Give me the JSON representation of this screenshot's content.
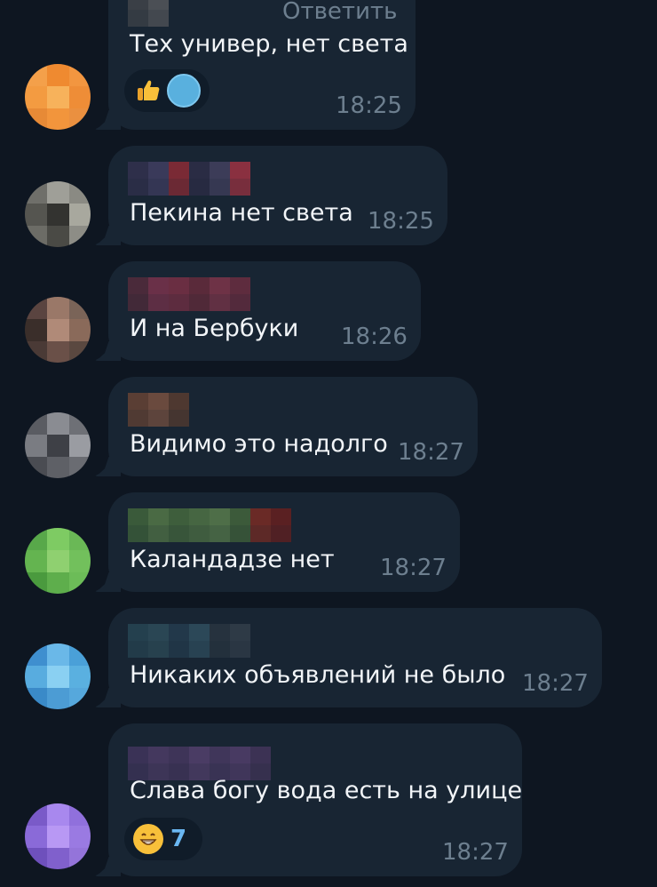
{
  "chat": {
    "messages": [
      {
        "text": "Тех универ, нет света",
        "time": "18:25",
        "reply_label": "Ответить",
        "reactions": [
          "thumbs-up",
          "blue-avatar"
        ],
        "avatar_colors": [
          "#f4a04a",
          "#ef8a30",
          "#f29640",
          "#f39b41",
          "#f7b25b",
          "#ee8d37",
          "#e78a36",
          "#f2953c",
          "#ea9040"
        ],
        "sender_colors": [
          "#3a3f46",
          "#4b4f55"
        ]
      },
      {
        "text": "Пекина нет света",
        "time": "18:25",
        "avatar_colors": [
          "#6f6f6a",
          "#9f9f98",
          "#8a8a83",
          "#555550",
          "#333330",
          "#a8a89e",
          "#6c6c66",
          "#4a4a45",
          "#8d8d86"
        ],
        "sender_colors": [
          "#2e2f4a",
          "#3a3a5a",
          "#7a2a35",
          "#2a2c44",
          "#3c3c58",
          "#8a3040"
        ]
      },
      {
        "text": "И на Бербуки",
        "time": "18:26",
        "avatar_colors": [
          "#5a4440",
          "#9a7868",
          "#7a6458",
          "#3a2e2a",
          "#b08a78",
          "#8a6a5a",
          "#4a3a36",
          "#6a5048",
          "#5a4840"
        ],
        "sender_colors": [
          "#4a2a3a",
          "#6a3048",
          "#6a2e42",
          "#5a2a3a",
          "#6e3246",
          "#5e2c3e"
        ]
      },
      {
        "text": "Видимо это надолго",
        "time": "18:27",
        "avatar_colors": [
          "#5a5c62",
          "#8a8c92",
          "#6e7076",
          "#7a7c82",
          "#3e4046",
          "#9a9ca2",
          "#4a4c52",
          "#5e6066",
          "#6a6c72"
        ],
        "sender_colors": [
          "#5a3e34",
          "#6a4a3e",
          "#4e3830"
        ]
      },
      {
        "text": "Каландадзе нет",
        "time": "18:27",
        "avatar_colors": [
          "#58a84a",
          "#7ecb63",
          "#6ab856",
          "#64b450",
          "#8fd070",
          "#72c05c",
          "#4a9a3e",
          "#5eae4c",
          "#6cbc58"
        ],
        "sender_colors": [
          "#3a5a3a",
          "#4a6a44",
          "#3e5e3c",
          "#466642",
          "#4e6e48",
          "#3c5a3a",
          "#6a2a26",
          "#5a2022"
        ]
      },
      {
        "text": "Никаких объявлений не было",
        "time": "18:27",
        "avatar_colors": [
          "#3f8fcf",
          "#6ab8e8",
          "#4aa0d8",
          "#58acdf",
          "#8ad0f2",
          "#5ab0e0",
          "#3a8ac8",
          "#4c9cd4",
          "#56a8dc"
        ],
        "sender_colors": [
          "#24404e",
          "#2a4654",
          "#22384a",
          "#2c4858",
          "#26323e",
          "#2e3a46"
        ]
      },
      {
        "text": "Слава богу вода есть на улице",
        "time": "18:27",
        "reactions": [
          "grin"
        ],
        "reaction_count": "7",
        "avatar_colors": [
          "#7a5ac8",
          "#a888ee",
          "#9070dc",
          "#8a6ad8",
          "#b898f4",
          "#9a7ae2",
          "#6e50bc",
          "#8060cc",
          "#9474da"
        ],
        "sender_colors": [
          "#3a3256",
          "#44385e",
          "#3e3458",
          "#4a3c64",
          "#40365a",
          "#483a62",
          "#3c3254"
        ]
      }
    ]
  }
}
